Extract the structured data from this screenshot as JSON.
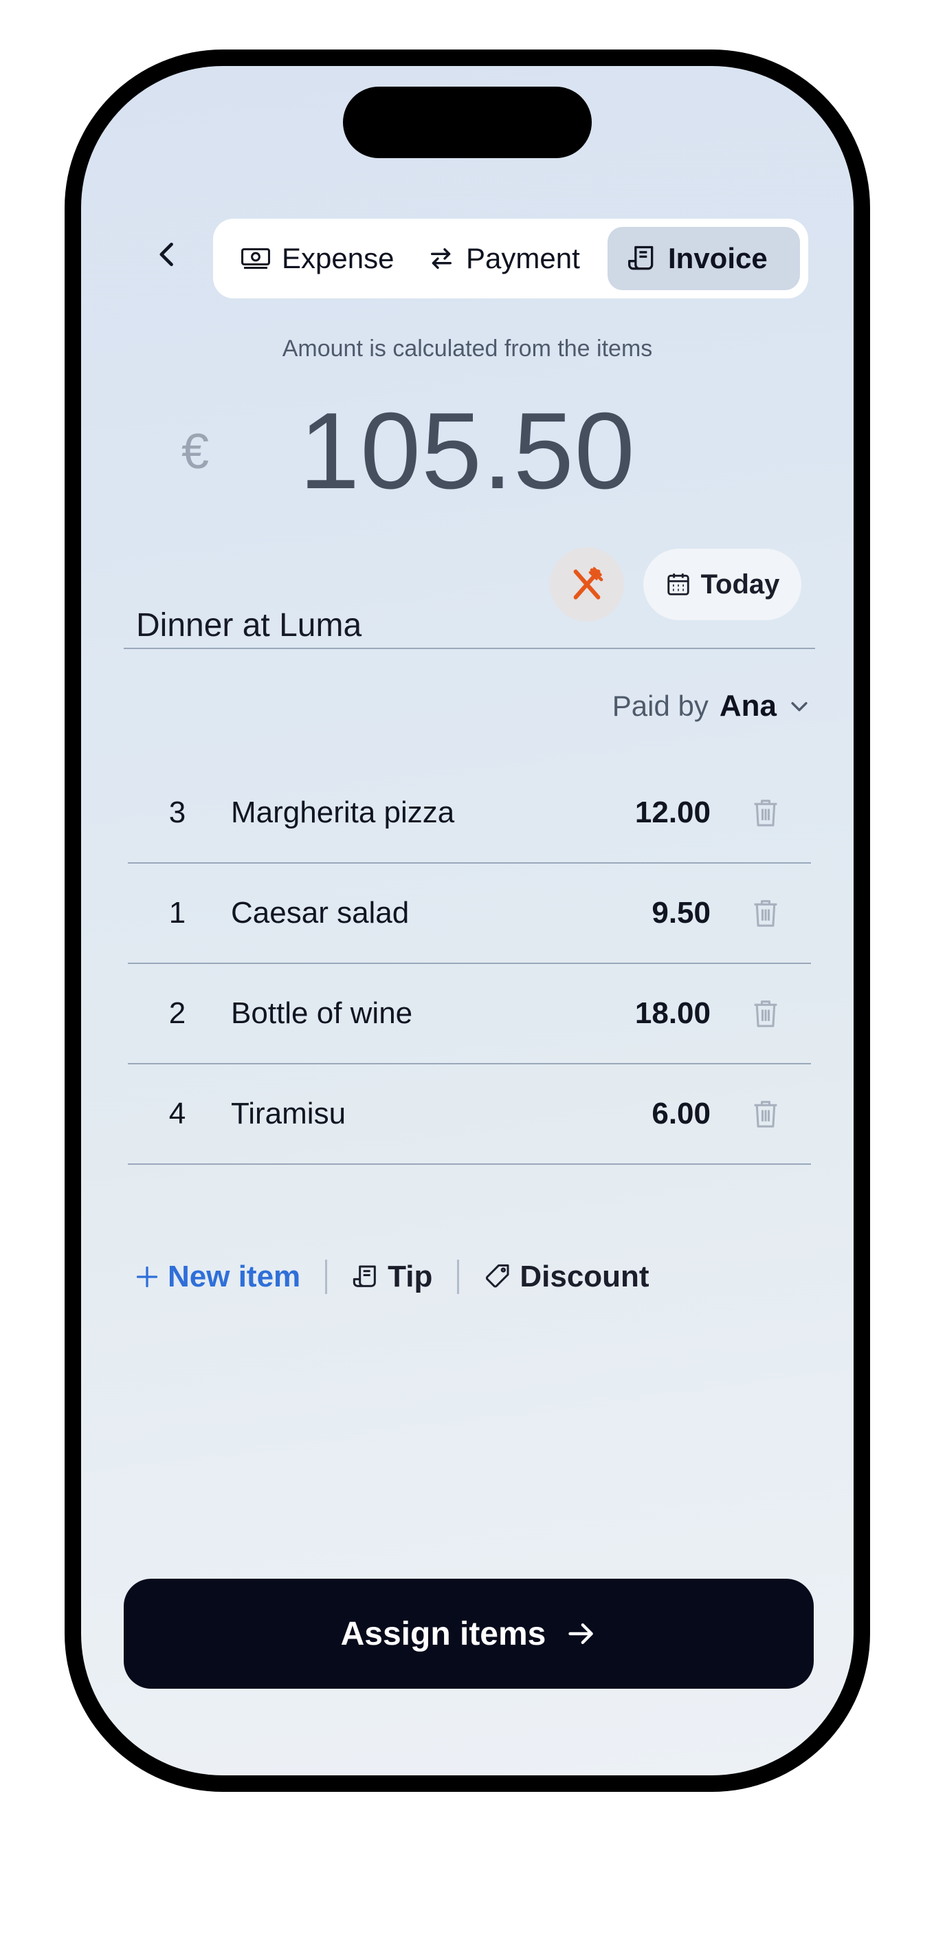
{
  "header": {
    "back_icon": "chevron-left-icon",
    "tabs": [
      {
        "label": "Expense",
        "icon": "banknote-icon",
        "active": false
      },
      {
        "label": "Payment",
        "icon": "swap-arrows-icon",
        "active": false
      },
      {
        "label": "Invoice",
        "icon": "receipt-icon",
        "active": true
      }
    ]
  },
  "summary": {
    "hint": "Amount is calculated from the items",
    "currency": "€",
    "amount": "105.50"
  },
  "details": {
    "title_value": "Dinner at Luma",
    "category_icon": "fork-knife-icon",
    "category_color": "#e6571a",
    "date_label": "Today"
  },
  "paid_by": {
    "label": "Paid by",
    "name": "Ana"
  },
  "items": [
    {
      "qty": "3",
      "name": "Margherita pizza",
      "price": "12.00"
    },
    {
      "qty": "1",
      "name": "Caesar salad",
      "price": "9.50"
    },
    {
      "qty": "2",
      "name": "Bottle of wine",
      "price": "18.00"
    },
    {
      "qty": "4",
      "name": "Tiramisu",
      "price": "6.00"
    }
  ],
  "actions": {
    "new_item": "New item",
    "tip": "Tip",
    "discount": "Discount"
  },
  "cta": {
    "label": "Assign items"
  },
  "colors": {
    "accent_blue": "#2f6fd8",
    "cta_bg": "#060a1b"
  }
}
